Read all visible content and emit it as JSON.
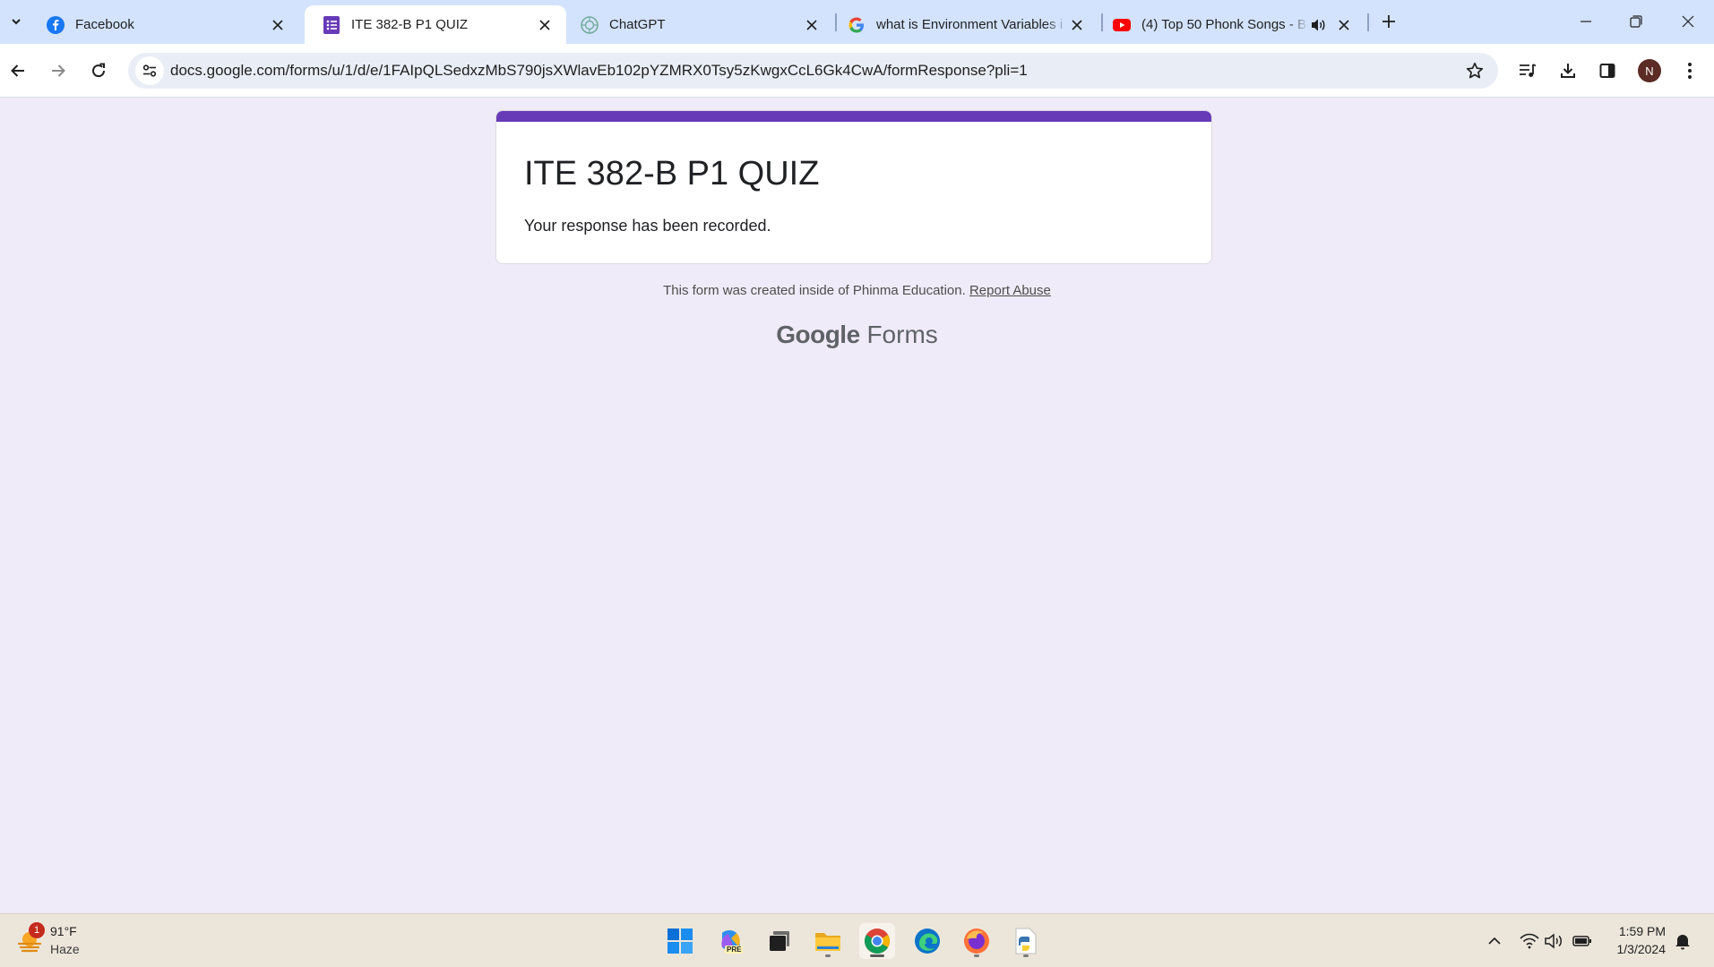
{
  "browser": {
    "tabs": [
      {
        "title": "Facebook",
        "favicon": "facebook-icon"
      },
      {
        "title": "ITE 382-B P1 QUIZ",
        "favicon": "google-forms-icon",
        "active": true
      },
      {
        "title": "ChatGPT",
        "favicon": "chatgpt-icon"
      },
      {
        "title": "what is Environment Variables i",
        "favicon": "google-icon"
      },
      {
        "title": "(4) Top 50 Phonk Songs - Be",
        "favicon": "youtube-icon",
        "audio": true
      }
    ],
    "url": "docs.google.com/forms/u/1/d/e/1FAIpQLSedxzMbS790jsXWlavEb102pYZMRX0Tsy5zKwgxCcL6Gk4CwA/formResponse?pli=1",
    "profile_initial": "N"
  },
  "form": {
    "title": "ITE 382-B P1 QUIZ",
    "message": "Your response has been recorded.",
    "footer_text": "This form was created inside of Phinma Education.",
    "report_link": "Report Abuse",
    "brand_google": "Google",
    "brand_forms": "Forms",
    "accent_color": "#673ab7"
  },
  "taskbar": {
    "weather_temp": "91°F",
    "weather_desc": "Haze",
    "weather_badge": "1",
    "time": "1:59 PM",
    "date": "1/3/2024",
    "copilot_badge": "PRE"
  }
}
